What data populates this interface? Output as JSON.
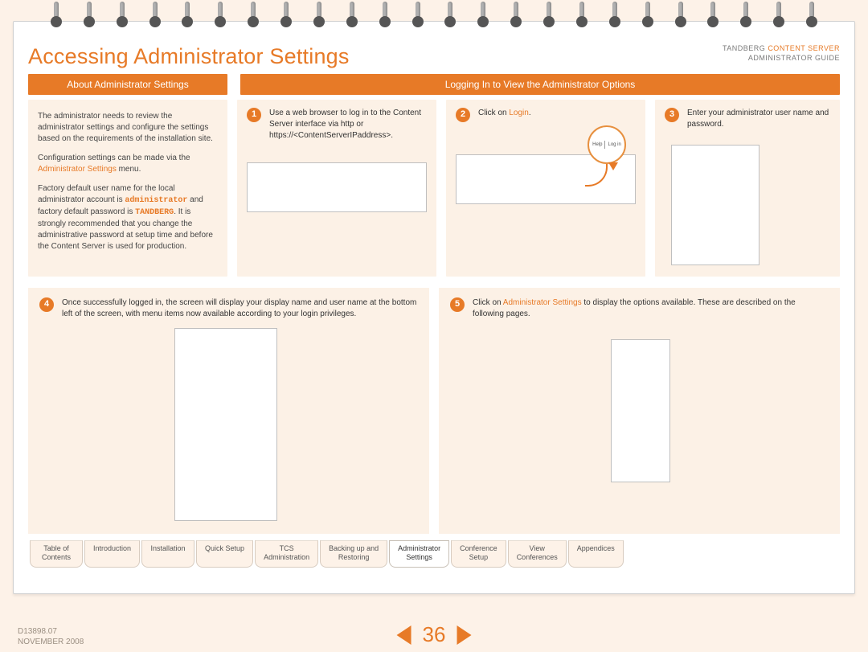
{
  "header": {
    "title": "Accessing Administrator Settings",
    "brand_pre": "TANDBERG ",
    "brand_accent": "CONTENT SERVER",
    "brand_sub": "ADMINISTRATOR GUIDE"
  },
  "section_bars": {
    "left": "About Administrator Settings",
    "right": "Logging In to View the Administrator Options"
  },
  "about": {
    "p1": "The administrator needs to review the administrator settings and configure the settings based on the requirements of the installation site.",
    "p2a": "Configuration settings can be made via the ",
    "p2_link": "Administrator Settings",
    "p2b": " menu.",
    "p3a": "Factory default user name for the local administrator account is ",
    "p3_user": "administrator",
    "p3b": " and factory default password is ",
    "p3_pass": "TANDBERG",
    "p3c": ". It is strongly recommended that you change the administrative password at setup time and before the Content Server is used for production."
  },
  "steps": {
    "s1_num": "1",
    "s1_text": "Use a web browser to log in to the Content Server interface via http or https://<ContentServerIPaddress>.",
    "s2_num": "2",
    "s2_a": "Click on ",
    "s2_link": "Login",
    "s2_b": ".",
    "s2_mag_left": "Help",
    "s2_mag_right": "Log in",
    "s3_num": "3",
    "s3_text": "Enter your administrator user name and password.",
    "s4_num": "4",
    "s4_text": "Once successfully logged in, the screen will display your display name and user name at the bottom left of the screen, with menu items now available according to your login privileges.",
    "s5_num": "5",
    "s5_a": "Click on ",
    "s5_link": "Administrator Settings",
    "s5_b": " to display the options available. These are described on the following pages."
  },
  "tabs": {
    "t0a": "Table of",
    "t0b": "Contents",
    "t1": "Introduction",
    "t2": "Installation",
    "t3": "Quick Setup",
    "t4a": "TCS",
    "t4b": "Administration",
    "t5a": "Backing up and",
    "t5b": "Restoring",
    "t6a": "Administrator",
    "t6b": "Settings",
    "t7a": "Conference",
    "t7b": "Setup",
    "t8a": "View",
    "t8b": "Conferences",
    "t9": "Appendices"
  },
  "footer": {
    "doc_id": "D13898.07",
    "date": "NOVEMBER 2008",
    "page": "36"
  }
}
